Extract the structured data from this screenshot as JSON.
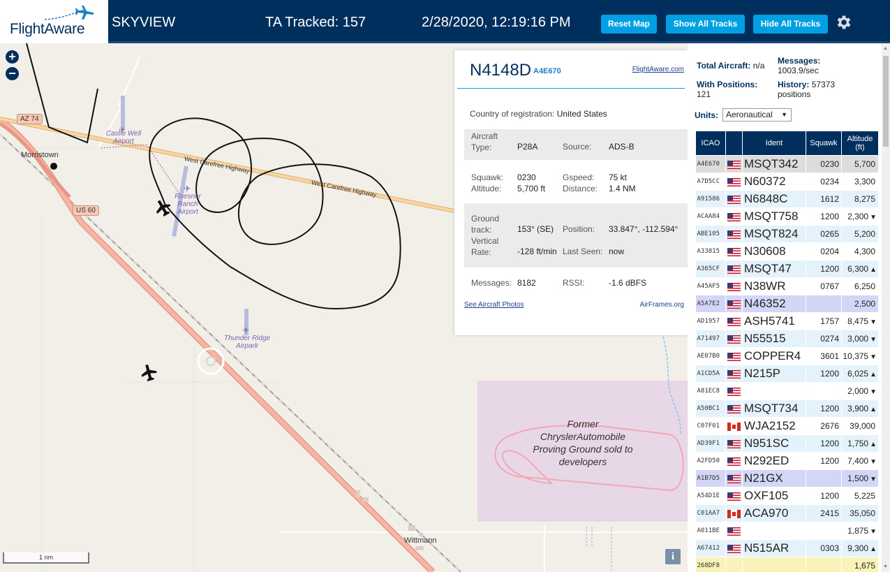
{
  "header": {
    "brand": "FlightAware",
    "app_title": "SKYVIEW",
    "ta_tracked": "TA Tracked: 157",
    "datetime": "2/28/2020, 12:19:16 PM",
    "btn_reset": "Reset Map",
    "btn_show": "Show All Tracks",
    "btn_hide": "Hide All Tracks",
    "settings_icon": "gear-icon"
  },
  "map": {
    "zoom_in": "+",
    "zoom_out": "−",
    "labels": {
      "morristown": "Morristown",
      "wittmann": "Wittmann",
      "az74": "AZ 74",
      "us60": "US 60",
      "hwy1": "West Carefree Highway",
      "hwy2": "West Carefree Highway",
      "castle_well": "Castle Well Airport",
      "roesner": "Roesner Ranch Airport",
      "thunder": "Thunder Ridge Airpark",
      "proving": "Former ChryslerAutomobile Proving Ground sold to developers"
    },
    "scale": "1 nm",
    "info": "i"
  },
  "selected": {
    "callsign": "N4148D",
    "hex": "A4E670",
    "flightaware_link": "FlightAware.com",
    "country_label": "Country of registration:",
    "country": "United States",
    "aircraft_type_label": "Aircraft Type:",
    "aircraft_type": "P28A",
    "source_label": "Source:",
    "source": "ADS-B",
    "squawk_label": "Squawk:",
    "squawk": "0230",
    "gspeed_label": "Gspeed:",
    "gspeed": "75 kt",
    "altitude_label": "Altitude:",
    "altitude": "5,700 ft",
    "distance_label": "Distance:",
    "distance": "1.4 NM",
    "ground_track_label": "Ground track:",
    "ground_track": "153° (SE)",
    "position_label": "Position:",
    "position": "33.847°, -112.594°",
    "vertical_rate_label": "Vertical Rate:",
    "vertical_rate": "-128 ft/min",
    "last_seen_label": "Last Seen:",
    "last_seen": "now",
    "messages_label": "Messages:",
    "messages": "8182",
    "rssi_label": "RSSI:",
    "rssi": "-1.6 dBFS",
    "photos_link": "See Aircraft Photos",
    "airframes_link": "AirFrames.org"
  },
  "side": {
    "total_aircraft_label": "Total Aircraft:",
    "total_aircraft": "n/a",
    "messages_label": "Messages:",
    "messages_rate": "1003.9/sec",
    "with_positions_label": "With Positions:",
    "with_positions": "121",
    "history_label": "History:",
    "history": "57373 positions",
    "units_label": "Units:",
    "units_value": "Aeronautical",
    "columns": [
      "ICAO",
      "",
      "Ident",
      "Squawk",
      "Altitude (ft)"
    ],
    "rows": [
      {
        "icao": "A4E670",
        "flag": "us",
        "ident": "MSQT342",
        "squawk": "0230",
        "alt": "5,700",
        "trend": "",
        "state": "selected"
      },
      {
        "icao": "A7D5CC",
        "flag": "us",
        "ident": "N60372",
        "squawk": "0234",
        "alt": "3,300",
        "trend": "",
        "state": ""
      },
      {
        "icao": "A91586",
        "flag": "us",
        "ident": "N6848C",
        "squawk": "1612",
        "alt": "8,275",
        "trend": "",
        "state": ""
      },
      {
        "icao": "ACAA84",
        "flag": "us",
        "ident": "MSQT758",
        "squawk": "1200",
        "alt": "2,300",
        "trend": "▼",
        "state": ""
      },
      {
        "icao": "ABE105",
        "flag": "us",
        "ident": "MSQT824",
        "squawk": "0265",
        "alt": "5,200",
        "trend": "",
        "state": ""
      },
      {
        "icao": "A33815",
        "flag": "us",
        "ident": "N30608",
        "squawk": "0204",
        "alt": "4,300",
        "trend": "",
        "state": ""
      },
      {
        "icao": "A365CF",
        "flag": "us",
        "ident": "MSQT47",
        "squawk": "1200",
        "alt": "6,300",
        "trend": "▲",
        "state": ""
      },
      {
        "icao": "A45AF5",
        "flag": "us",
        "ident": "N38WR",
        "squawk": "0767",
        "alt": "6,250",
        "trend": "",
        "state": ""
      },
      {
        "icao": "A5A7E2",
        "flag": "us",
        "ident": "N46352",
        "squawk": "",
        "alt": "2,500",
        "trend": "",
        "state": "highlight"
      },
      {
        "icao": "AD1957",
        "flag": "us",
        "ident": "ASH5741",
        "squawk": "1757",
        "alt": "8,475",
        "trend": "▼",
        "state": ""
      },
      {
        "icao": "A71497",
        "flag": "us",
        "ident": "N55515",
        "squawk": "0274",
        "alt": "3,000",
        "trend": "▼",
        "state": ""
      },
      {
        "icao": "AE07B0",
        "flag": "us",
        "ident": "COPPER4",
        "squawk": "3601",
        "alt": "10,375",
        "trend": "▼",
        "state": ""
      },
      {
        "icao": "A1CD5A",
        "flag": "us",
        "ident": "N215P",
        "squawk": "1200",
        "alt": "6,025",
        "trend": "▲",
        "state": ""
      },
      {
        "icao": "A81EC8",
        "flag": "us",
        "ident": "",
        "squawk": "",
        "alt": "2,000",
        "trend": "▼",
        "state": ""
      },
      {
        "icao": "A50BC1",
        "flag": "us",
        "ident": "MSQT734",
        "squawk": "1200",
        "alt": "3,900",
        "trend": "▲",
        "state": ""
      },
      {
        "icao": "C07F01",
        "flag": "ca",
        "ident": "WJA2152",
        "squawk": "2676",
        "alt": "39,000",
        "trend": "",
        "state": ""
      },
      {
        "icao": "AD39F1",
        "flag": "us",
        "ident": "N951SC",
        "squawk": "1200",
        "alt": "1,750",
        "trend": "▲",
        "state": ""
      },
      {
        "icao": "A2FD50",
        "flag": "us",
        "ident": "N292ED",
        "squawk": "1200",
        "alt": "7,400",
        "trend": "▼",
        "state": ""
      },
      {
        "icao": "A1B7D5",
        "flag": "us",
        "ident": "N21GX",
        "squawk": "",
        "alt": "1,500",
        "trend": "▼",
        "state": "highlight"
      },
      {
        "icao": "A54D1E",
        "flag": "us",
        "ident": "OXF105",
        "squawk": "1200",
        "alt": "5,225",
        "trend": "",
        "state": ""
      },
      {
        "icao": "C01AA7",
        "flag": "ca",
        "ident": "ACA970",
        "squawk": "2415",
        "alt": "35,050",
        "trend": "",
        "state": ""
      },
      {
        "icao": "A011BE",
        "flag": "us",
        "ident": "",
        "squawk": "",
        "alt": "1,875",
        "trend": "▼",
        "state": ""
      },
      {
        "icao": "A67412",
        "flag": "us",
        "ident": "N515AR",
        "squawk": "0303",
        "alt": "9,300",
        "trend": "▲",
        "state": ""
      },
      {
        "icao": "268DF8",
        "flag": "",
        "ident": "",
        "squawk": "",
        "alt": "1,675",
        "trend": "",
        "state": "cut"
      }
    ]
  }
}
